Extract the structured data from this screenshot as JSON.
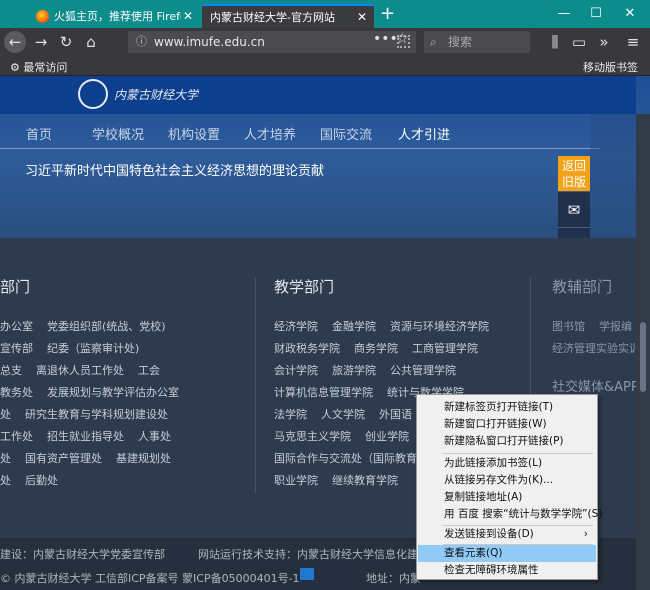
{
  "browser": {
    "tabs": [
      {
        "label": "火狐主页，推荐使用 Firefox 火...",
        "active": false
      },
      {
        "label": "内蒙古财经大学-官方网站",
        "active": true
      }
    ],
    "new_tab": "+",
    "window_controls": {
      "minimize": "—",
      "maximize": "☐",
      "close": "✕"
    },
    "url": "www.imufe.edu.cn",
    "search_placeholder": "搜索",
    "bookmarks_left": "最常访问",
    "bookmarks_right": "移动版书签"
  },
  "site": {
    "logo_text": "内蒙古财经大学",
    "nav": [
      "首页",
      "学校概况",
      "机构设置",
      "人才培养",
      "国际交流",
      "人才引进"
    ],
    "headline": "习近平新时代中国特色社会主义经济思想的理论贡献",
    "sidebar": {
      "return_label": "返回旧版"
    },
    "columns": {
      "left_title": "部门",
      "mid_title": "教学部门",
      "right_title": "教辅部门",
      "right_title2": "社交媒体&APP",
      "left_links": [
        [
          "办公室",
          "党委组织部(统战、党校)"
        ],
        [
          "宣传部",
          "纪委（监察审计处)"
        ],
        [
          "总支",
          "离退休人员工作处",
          "工会"
        ],
        [
          "教务处",
          "发展规划与教学评估办公室"
        ],
        [
          "处",
          "研究生教育与学科规划建设处"
        ],
        [
          "工作处",
          "招生就业指导处",
          "人事处"
        ],
        [
          "处",
          "国有资产管理处",
          "基建规划处"
        ],
        [
          "处",
          "后勤处"
        ]
      ],
      "mid_links": [
        [
          "经济学院",
          "金融学院",
          "资源与环境经济学院"
        ],
        [
          "财政税务学院",
          "商务学院",
          "工商管理学院"
        ],
        [
          "会计学院",
          "旅游学院",
          "公共管理学院"
        ],
        [
          "计算机信息管理学院",
          "统计与数学学院"
        ],
        [
          "法学院",
          "人文学院",
          "外国语"
        ],
        [
          "马克思主义学院",
          "创业学院"
        ],
        [
          "国际合作与交流处（国际教育"
        ],
        [
          "职业学院",
          "继续教育学院"
        ]
      ],
      "right_links": [
        [
          "图书馆",
          "学报编"
        ],
        [
          "经济管理实验实训"
        ]
      ]
    },
    "footer": {
      "line1_left": "建设：内蒙古财经大学党委宣传部",
      "line1_right": "网站运行技术支持：内蒙古财经大学信息化建",
      "line2_left": "© 内蒙古财经大学 工信部ICP备案号 蒙ICP备05000401号-1",
      "line2_right": "地址：内蒙"
    }
  },
  "context_menu": {
    "items": [
      {
        "label": "新建标签页打开链接(T)"
      },
      {
        "label": "新建窗口打开链接(W)"
      },
      {
        "label": "新建隐私窗口打开链接(P)"
      },
      {
        "label": "为此链接添加书签(L)"
      },
      {
        "label": "从链接另存文件为(K)..."
      },
      {
        "label": "复制链接地址(A)"
      },
      {
        "label": "用 百度 搜索“统计与数学学院”(S)"
      },
      {
        "label": "发送链接到设备(D)"
      },
      {
        "label": "查看元素(Q)"
      },
      {
        "label": "检查无障碍环境属性"
      }
    ]
  },
  "colors": {
    "titlebar": "#0d8c8c",
    "accent": "#f2a31a",
    "highlight": "#91c9f7"
  }
}
